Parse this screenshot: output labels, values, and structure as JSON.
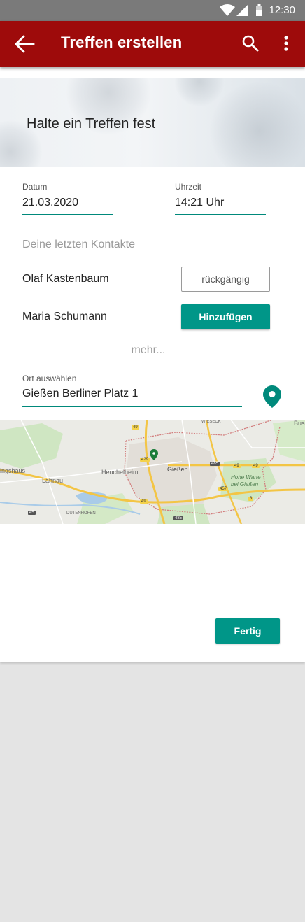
{
  "status_bar": {
    "time": "12:30"
  },
  "app_bar": {
    "title": "Treffen erstellen",
    "back_icon": "arrow-back-icon",
    "search_icon": "search-icon",
    "menu_icon": "more-vert-icon"
  },
  "hero": {
    "title": "Halte ein Treffen fest"
  },
  "date_field": {
    "label": "Datum",
    "value": "21.03.2020"
  },
  "time_field": {
    "label": "Uhrzeit",
    "value": "14:21 Uhr"
  },
  "contacts": {
    "section_title": "Deine letzten Kontakte",
    "items": [
      {
        "name": "Olaf Kastenbaum",
        "action_label": "rückgängig"
      },
      {
        "name": "Maria Schumann",
        "action_label": "Hinzufügen"
      }
    ],
    "more_label": "mehr..."
  },
  "location": {
    "label": "Ort auswählen",
    "value": "Gießen Berliner Platz 1",
    "pin_icon": "location-pin-icon"
  },
  "map": {
    "labels": {
      "giessen": "Gießen",
      "heuchelheim": "Heuchelheim",
      "lahnau": "Lahnau",
      "hohe_warte": "Hohe Warte\nbei Gießen",
      "wieseck": "WIESECK",
      "busec": "Buse",
      "ingshausen": "ingshaus",
      "dutenhofen": "DUTENHOFEN"
    },
    "road_numbers": [
      "429",
      "49",
      "49",
      "485",
      "49",
      "457",
      "45",
      "485",
      "3",
      "49"
    ]
  },
  "actions": {
    "done_label": "Fertig"
  },
  "colors": {
    "app_bar": "#9e0b0b",
    "accent": "#009688",
    "status_bar": "#7a7a7a"
  }
}
